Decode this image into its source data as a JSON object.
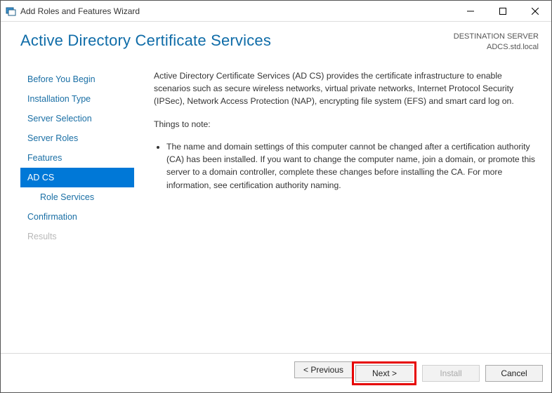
{
  "window": {
    "title": "Add Roles and Features Wizard"
  },
  "header": {
    "page_title": "Active Directory Certificate Services",
    "destination_label": "DESTINATION SERVER",
    "destination_value": "ADCS.std.local"
  },
  "nav": {
    "items": [
      {
        "label": "Before You Begin",
        "state": "normal"
      },
      {
        "label": "Installation Type",
        "state": "normal"
      },
      {
        "label": "Server Selection",
        "state": "normal"
      },
      {
        "label": "Server Roles",
        "state": "normal"
      },
      {
        "label": "Features",
        "state": "normal"
      },
      {
        "label": "AD CS",
        "state": "selected"
      },
      {
        "label": "Role Services",
        "state": "normal",
        "sub": true
      },
      {
        "label": "Confirmation",
        "state": "normal"
      },
      {
        "label": "Results",
        "state": "disabled"
      }
    ]
  },
  "content": {
    "intro": "Active Directory Certificate Services (AD CS) provides the certificate infrastructure to enable scenarios such as secure wireless networks, virtual private networks, Internet Protocol Security (IPSec), Network Access Protection (NAP), encrypting file system (EFS) and smart card log on.",
    "note_heading": "Things to note:",
    "notes": [
      "The name and domain settings of this computer cannot be changed after a certification authority (CA) has been installed. If you want to change the computer name, join a domain, or promote this server to a domain controller, complete these changes before installing the CA. For more information, see certification authority naming."
    ]
  },
  "footer": {
    "previous": "< Previous",
    "next": "Next >",
    "install": "Install",
    "cancel": "Cancel"
  }
}
